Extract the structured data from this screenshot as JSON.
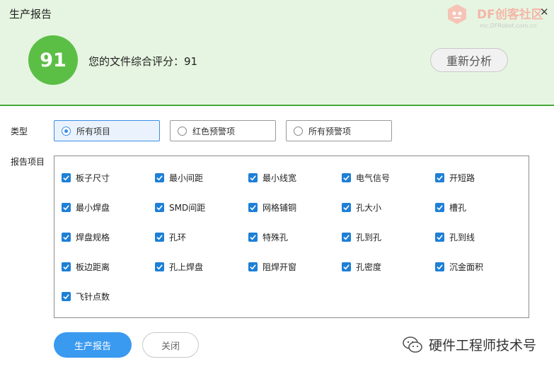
{
  "window": {
    "title": "生产报告",
    "close_glyph": "✕"
  },
  "watermark": {
    "brand": "DF创客社区",
    "url": "mc.DFRobot.com.cn"
  },
  "score": {
    "value": "91",
    "summary": "您的文件综合评分：91",
    "reanalyze_label": "重新分析"
  },
  "type_section": {
    "label": "类型",
    "options": [
      {
        "label": "所有项目",
        "selected": true
      },
      {
        "label": "红色预警项",
        "selected": false
      },
      {
        "label": "所有预警项",
        "selected": false
      }
    ]
  },
  "report_section": {
    "label": "报告项目",
    "items": [
      {
        "label": "板子尺寸",
        "checked": true
      },
      {
        "label": "最小间距",
        "checked": true
      },
      {
        "label": "最小线宽",
        "checked": true
      },
      {
        "label": "电气信号",
        "checked": true
      },
      {
        "label": "开短路",
        "checked": true
      },
      {
        "label": "最小焊盘",
        "checked": true
      },
      {
        "label": "SMD间距",
        "checked": true
      },
      {
        "label": "网格铺铜",
        "checked": true
      },
      {
        "label": "孔大小",
        "checked": true
      },
      {
        "label": "槽孔",
        "checked": true
      },
      {
        "label": "焊盘规格",
        "checked": true
      },
      {
        "label": "孔环",
        "checked": true
      },
      {
        "label": "特殊孔",
        "checked": true
      },
      {
        "label": "孔到孔",
        "checked": true
      },
      {
        "label": "孔到线",
        "checked": true
      },
      {
        "label": "板边距离",
        "checked": true
      },
      {
        "label": "孔上焊盘",
        "checked": true
      },
      {
        "label": "阻焊开窗",
        "checked": true
      },
      {
        "label": "孔密度",
        "checked": true
      },
      {
        "label": "沉金面积",
        "checked": true
      },
      {
        "label": "飞针点数",
        "checked": true
      }
    ]
  },
  "footer": {
    "generate_label": "生产报告",
    "close_label": "关闭",
    "wechat_account": "硬件工程师技术号"
  },
  "colors": {
    "accent": "#3a9af0",
    "score_green": "#5bbf45",
    "header_bg": "#e6f5e1",
    "checkbox": "#1e7fd6"
  }
}
